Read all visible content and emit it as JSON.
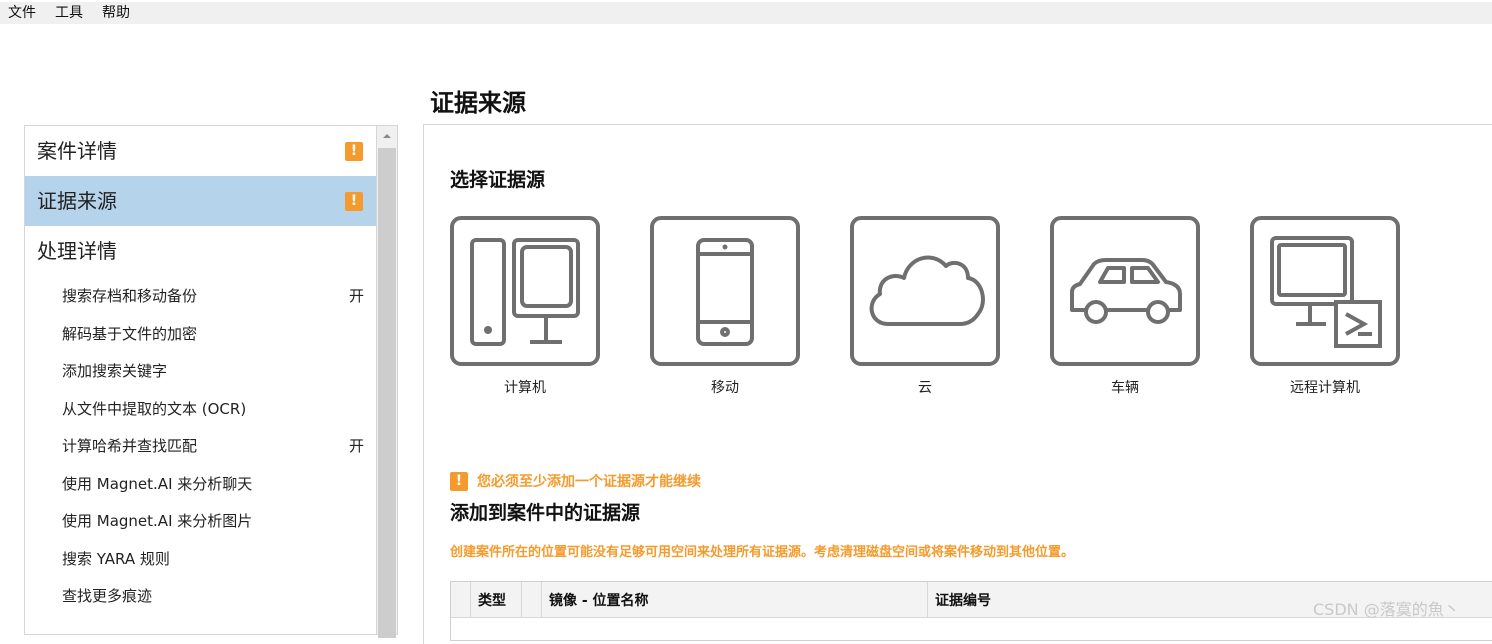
{
  "menu": [
    "文件",
    "工具",
    "帮助"
  ],
  "page_title": "证据来源",
  "sidebar": {
    "items": [
      {
        "label": "案件详情",
        "warning": "!"
      },
      {
        "label": "证据来源",
        "warning": "!",
        "selected": true
      },
      {
        "label": "处理详情"
      }
    ],
    "sub_items": [
      {
        "label": "搜索存档和移动备份",
        "state": "开"
      },
      {
        "label": "解码基于文件的加密",
        "state": ""
      },
      {
        "label": "添加搜索关键字",
        "state": ""
      },
      {
        "label": "从文件中提取的文本 (OCR)",
        "state": ""
      },
      {
        "label": "计算哈希并查找匹配",
        "state": "开"
      },
      {
        "label": "使用 Magnet.AI 来分析聊天",
        "state": ""
      },
      {
        "label": "使用 Magnet.AI 来分析图片",
        "state": ""
      },
      {
        "label": "搜索 YARA 规则",
        "state": ""
      },
      {
        "label": "查找更多痕迹",
        "state": ""
      }
    ]
  },
  "main": {
    "select_title": "选择证据源",
    "sources": [
      {
        "label": "计算机",
        "icon": "computer-icon"
      },
      {
        "label": "移动",
        "icon": "mobile-icon"
      },
      {
        "label": "云",
        "icon": "cloud-icon"
      },
      {
        "label": "车辆",
        "icon": "vehicle-icon"
      },
      {
        "label": "远程计算机",
        "icon": "remote-computer-icon"
      }
    ],
    "warning_badge": "!",
    "warning_text": "您必须至少添加一个证据源才能继续",
    "added_title": "添加到案件中的证据源",
    "space_warning": "创建案件所在的位置可能没有足够可用空间来处理所有证据源。考虑清理磁盘空间或将案件移动到其他位置。",
    "table": {
      "columns": [
        "",
        "类型",
        "",
        "镜像 - 位置名称",
        "证据编号"
      ]
    }
  },
  "watermark": "CSDN @落寞的魚丶",
  "colors": {
    "accent_warning": "#f59b2d",
    "selection": "#b5d3ea",
    "icon_stroke": "#6f6f6f"
  }
}
